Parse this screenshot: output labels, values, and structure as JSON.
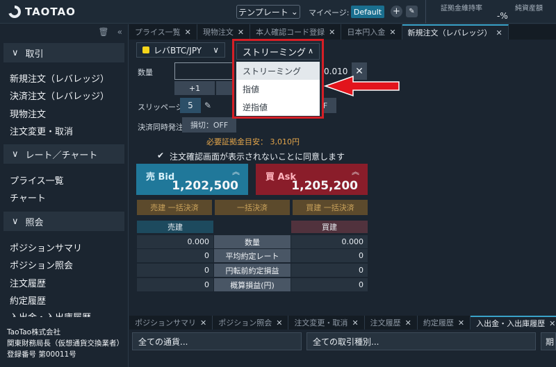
{
  "header": {
    "logo_text": "TAOTAO",
    "template_button": "テンプレート",
    "mypage_label": "マイページ:",
    "mypage_badge": "Default",
    "plus_icon": "+",
    "edit_icon": "✎",
    "margin_rate_label": "証拠金維持率",
    "net_assets_label": "純資産額",
    "net_assets_value": "-%"
  },
  "sidebar": {
    "sections": [
      {
        "label": "取引",
        "items": [
          "新規注文（レバレッジ）",
          "決済注文（レバレッジ）",
          "現物注文",
          "注文変更・取消"
        ]
      },
      {
        "label": "レート／チャート",
        "items": [
          "プライス一覧",
          "チャート"
        ]
      },
      {
        "label": "照会",
        "items": [
          "ポジションサマリ",
          "ポジション照会",
          "注文履歴",
          "約定履歴",
          "入出金・入出庫履歴"
        ]
      }
    ],
    "footer": [
      "TaoTao株式会社",
      "関東財務局長（仮想通貨交換業者）",
      "登録番号 第00011号"
    ]
  },
  "tabs": [
    {
      "label": "プライス一覧",
      "active": false
    },
    {
      "label": "現物注文",
      "active": false
    },
    {
      "label": "本人確認コード登録",
      "active": false
    },
    {
      "label": "日本円入金",
      "active": false
    },
    {
      "label": "新規注文（レバレッジ）",
      "active": true
    }
  ],
  "order": {
    "pair": "レバBTC/JPY",
    "quantity_label": "数量",
    "quantity_value": "0.010",
    "step_plus": "+1",
    "slippage_label": "スリッページ",
    "slippage_value": "5",
    "settle_label": "決済同時発注",
    "settle_toggle": "損切：OFF",
    "off_label": "F",
    "margin_note": "必要証拠金目安： 3,010円",
    "confirm_label": "注文確認画面が表示されないことに同意します",
    "bid_label": "売 Bid",
    "bid_price": "1,202,500",
    "ask_label": "買 Ask",
    "ask_price": "1,205,200",
    "settle_buttons": [
      "売建 一括決済",
      "一括決済",
      "買建 一括決済"
    ]
  },
  "positions": {
    "sell_header": "売建",
    "buy_header": "買建",
    "rows": [
      {
        "left": "0.000",
        "label": "数量",
        "right": "0.000"
      },
      {
        "left": "0",
        "label": "平均約定レート",
        "right": "0"
      },
      {
        "left": "0",
        "label": "円転前約定損益",
        "right": "0"
      },
      {
        "left": "0",
        "label": "概算損益(円)",
        "right": "0"
      }
    ]
  },
  "dropdown": {
    "current": "ストリーミング",
    "options": [
      "ストリーミング",
      "指値",
      "逆指値"
    ]
  },
  "bottom_tabs": [
    {
      "label": "ポジションサマリ",
      "active": false
    },
    {
      "label": "ポジション照会",
      "active": false
    },
    {
      "label": "注文変更・取消",
      "active": false
    },
    {
      "label": "注文履歴",
      "active": false
    },
    {
      "label": "約定履歴",
      "active": false
    },
    {
      "label": "入出金・入出庫履歴",
      "active": true
    }
  ],
  "filters": [
    "全ての通貨...",
    "全ての取引種別...",
    "期"
  ],
  "colors": {
    "accent": "#1a6f8f",
    "bid": "#20789a",
    "ask": "#8a1d2a",
    "highlight": "#d61f26",
    "warning": "#e3a54a"
  }
}
